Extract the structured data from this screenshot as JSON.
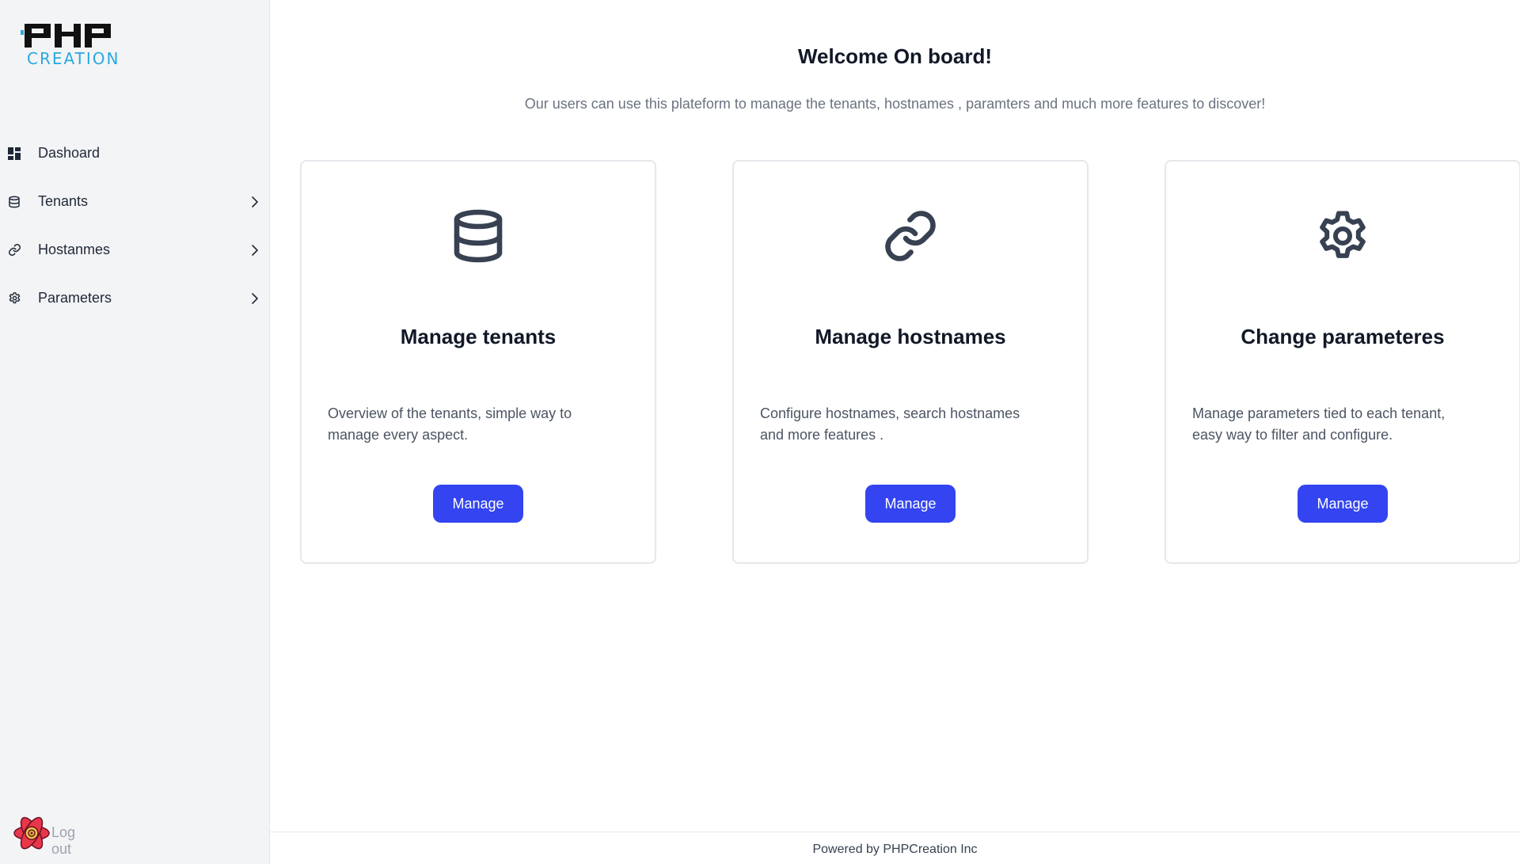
{
  "brand": {
    "logo_text": "PHP",
    "logo_subtext": "CREATION",
    "logo_color": "#111111",
    "accent_color": "#2aa8e0"
  },
  "sidebar": {
    "items": [
      {
        "label": "Dashoard",
        "icon": "dashboard-grid-icon",
        "has_chevron": false
      },
      {
        "label": "Tenants",
        "icon": "database-icon",
        "has_chevron": true
      },
      {
        "label": "Hostanmes",
        "icon": "link-icon",
        "has_chevron": true
      },
      {
        "label": "Parameters",
        "icon": "gear-icon",
        "has_chevron": true
      }
    ],
    "logout_label": "Log out",
    "logout_icon": "react-atom-icon"
  },
  "main": {
    "title": "Welcome On board!",
    "subtitle": "Our users can use this plateform to manage the tenants, hostnames , paramters and much more features to discover!",
    "cards": [
      {
        "icon": "database-icon",
        "title": "Manage tenants",
        "text": "Overview of the tenants, simple way to manage every aspect.",
        "button_label": "Manage"
      },
      {
        "icon": "link-icon",
        "title": "Manage hostnames",
        "text": "Configure hostnames, search hostnames and more features .",
        "button_label": "Manage"
      },
      {
        "icon": "gear-icon",
        "title": "Change parameteres",
        "text": "Manage parameters tied to each tenant, easy way to filter and configure.",
        "button_label": "Manage"
      }
    ]
  },
  "footer": {
    "text": "Powered by PHPCreation Inc"
  },
  "colors": {
    "primary_button": "#3344f0",
    "sidebar_bg": "#f3f4f6",
    "border": "#e5e7eb",
    "icon_dark": "#374151"
  }
}
